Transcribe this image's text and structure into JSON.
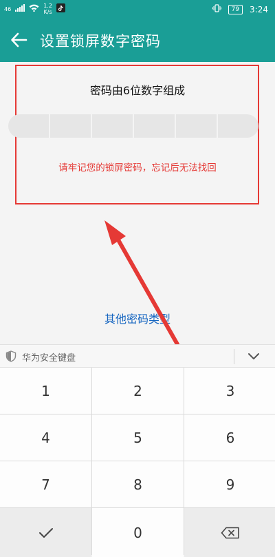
{
  "status": {
    "network_type": "46",
    "speed_value": "1.2",
    "speed_unit": "K/s",
    "battery": "79",
    "time": "3:24"
  },
  "header": {
    "title": "设置锁屏数字密码"
  },
  "main": {
    "heading": "密码由6位数字组成",
    "warning": "请牢记您的锁屏密码，忘记后无法找回",
    "other_types": "其他密码类型"
  },
  "keyboard": {
    "label": "华为安全键盘",
    "keys": [
      "1",
      "2",
      "3",
      "4",
      "5",
      "6",
      "7",
      "8",
      "9",
      "0"
    ]
  },
  "colors": {
    "accent": "#1a9e96",
    "annotation": "#e53935",
    "link": "#1565c0"
  }
}
